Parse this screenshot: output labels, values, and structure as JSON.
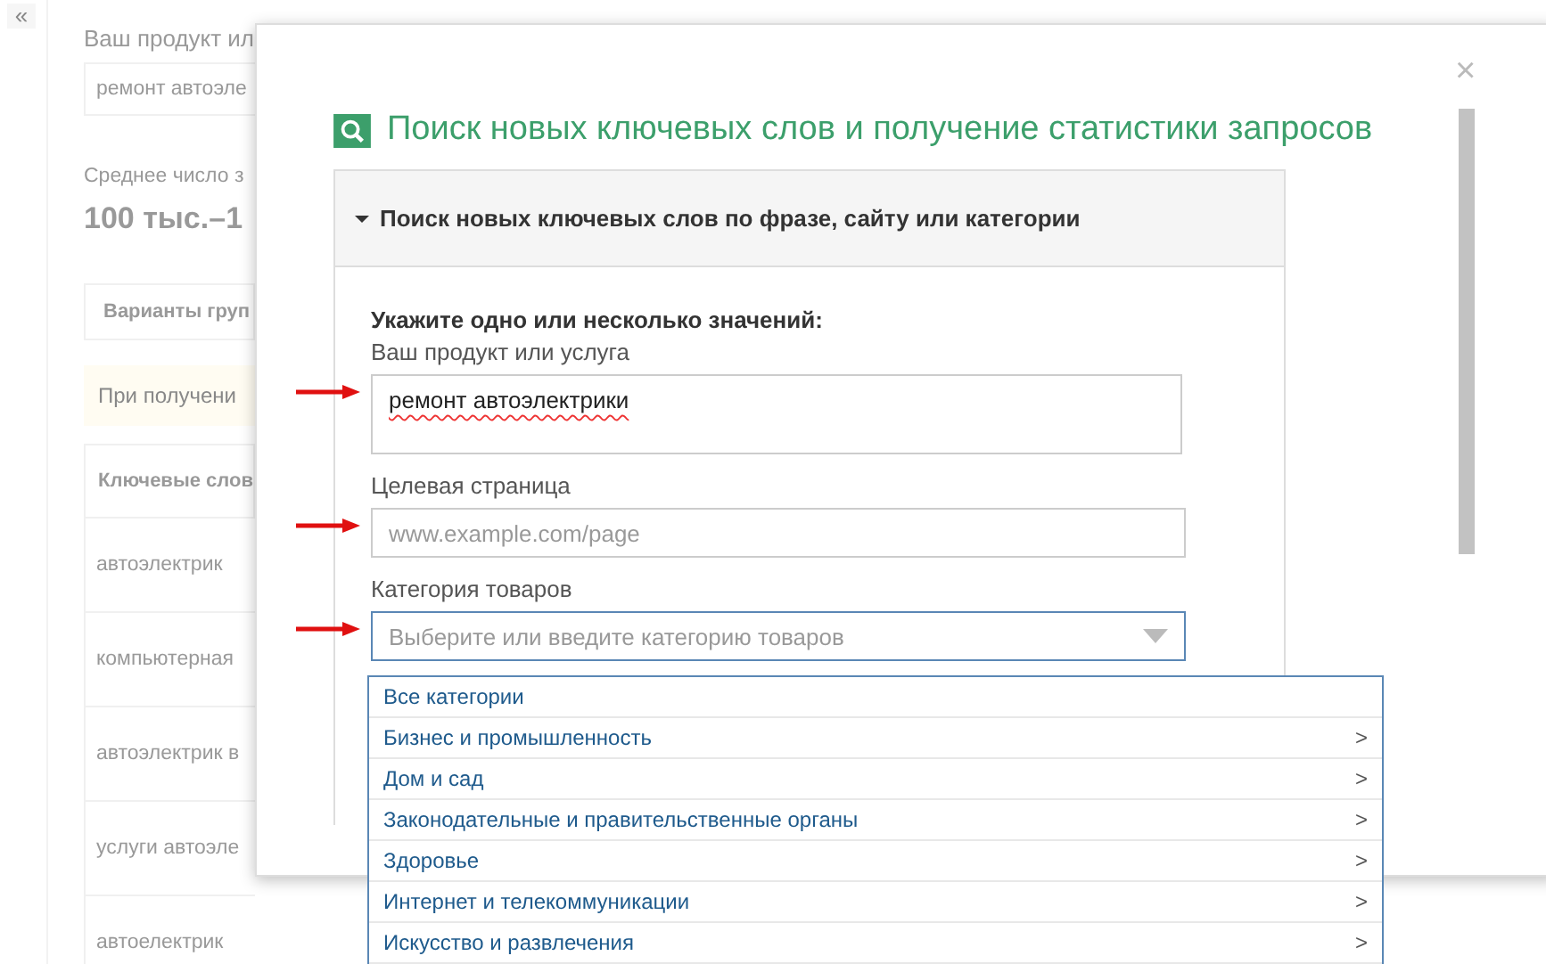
{
  "background": {
    "collapse_button": "«",
    "product_label": "Ваш продукт ил",
    "product_value": "ремонт автоэле",
    "average_label": "Среднее число з",
    "average_value": "100 тыс.–1",
    "tab": "Варианты груп",
    "notice": "При получени",
    "table_header": "Ключевые слов",
    "rows": [
      "автоэлектрик",
      "компьютерная",
      "автоэлектрик в",
      "услуги автоэле",
      "автоелектрик"
    ]
  },
  "dialog": {
    "title": "Поиск новых ключевых слов и получение статистики запросов",
    "close": "×",
    "section": {
      "title": "Поиск новых ключевых слов по фразе, сайту или категории",
      "expanded": true
    },
    "instruction": "Укажите одно или несколько значений:",
    "fields": [
      {
        "kind": "textarea",
        "label": "Ваш продукт или услуга",
        "value": "ремонт автоэлектрики",
        "arrow": true
      },
      {
        "kind": "input",
        "label": "Целевая страница",
        "placeholder": "www.example.com/page",
        "arrow": true
      },
      {
        "kind": "select",
        "label": "Категория товаров",
        "placeholder": "Выберите или введите категорию товаров",
        "arrow": true,
        "expanded": true
      }
    ],
    "options": [
      {
        "label": "Все категории",
        "has_children": false
      },
      {
        "label": "Бизнес и промышленность",
        "has_children": true,
        "arrow": ">"
      },
      {
        "label": "Дом и сад",
        "has_children": true,
        "arrow": ">"
      },
      {
        "label": "Законодательные и правительственные органы",
        "has_children": true,
        "arrow": ">"
      },
      {
        "label": "Здоровье",
        "has_children": true,
        "arrow": ">"
      },
      {
        "label": "Интернет и телекоммуникации",
        "has_children": true,
        "arrow": ">"
      },
      {
        "label": "Искусство и развлечения",
        "has_children": true,
        "arrow": ">"
      }
    ]
  }
}
